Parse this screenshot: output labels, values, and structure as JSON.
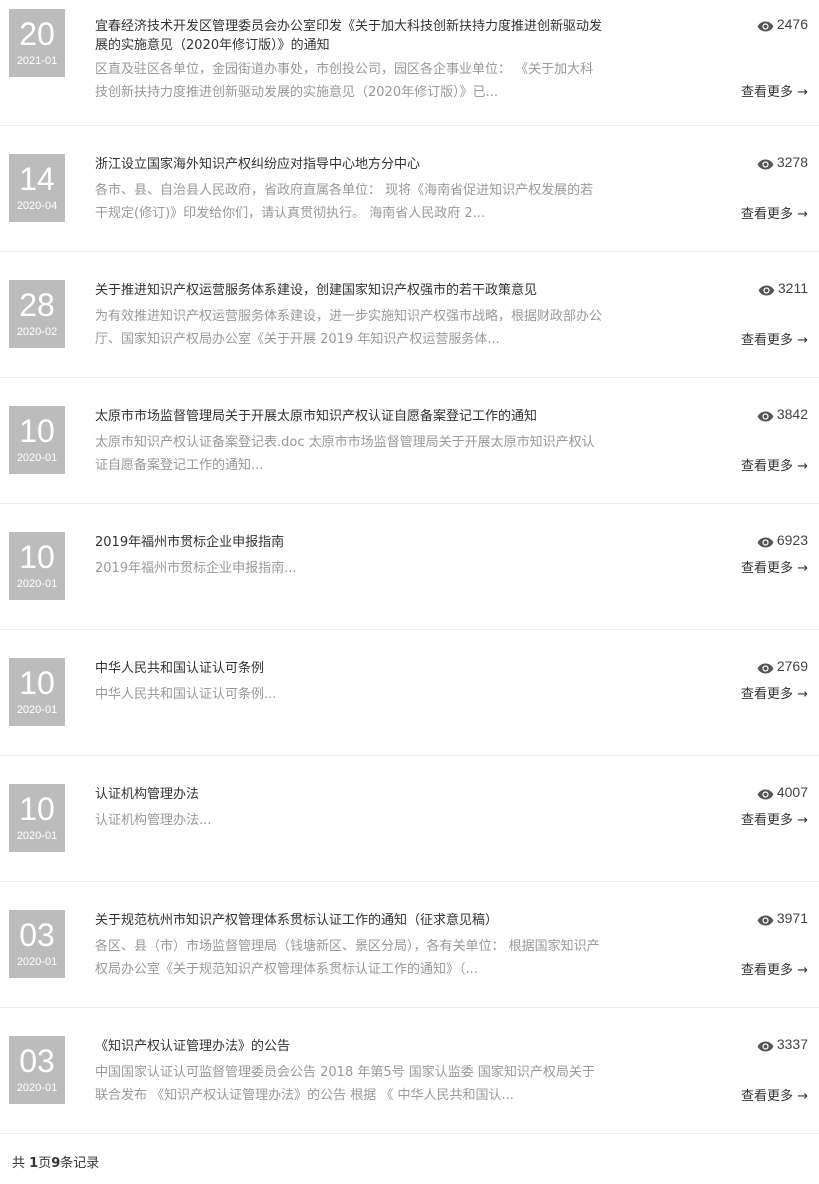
{
  "items": [
    {
      "day": "20",
      "ym": "2021-01",
      "title": "宜春经济技术开发区管理委员会办公室印发《关于加大科技创新扶持力度推进创新驱动发展的实施意见（2020年修订版）》的通知",
      "summary": "区直及驻区各单位，金园街道办事处，市创投公司，园区各企事业单位：  《关于加大科技创新扶持力度推进创新驱动发展的实施意见（2020年修订版）》已...",
      "views": "2476",
      "more": "查看更多 →"
    },
    {
      "day": "14",
      "ym": "2020-04",
      "title": "浙江设立国家海外知识产权纠纷应对指导中心地方分中心",
      "summary": "各市、县、自治县人民政府，省政府直属各单位：  现将《海南省促进知识产权发展的若干规定(修订)》印发给你们，请认真贯彻执行。  海南省人民政府  2...",
      "views": "3278",
      "more": "查看更多 →"
    },
    {
      "day": "28",
      "ym": "2020-02",
      "title": "关于推进知识产权运营服务体系建设，创建国家知识产权强市的若干政策意见",
      "summary": "为有效推进知识产权运营服务体系建设，进一步实施知识产权强市战略，根据财政部办公厅、国家知识产权局办公室《关于开展 2019 年知识产权运营服务体...",
      "views": "3211",
      "more": "查看更多 →"
    },
    {
      "day": "10",
      "ym": "2020-01",
      "title": "太原市市场监督管理局关于开展太原市知识产权认证自愿备案登记工作的通知",
      "summary": "太原市知识产权认证备案登记表.doc 太原市市场监督管理局关于开展太原市知识产权认证自愿备案登记工作的通知...",
      "views": "3842",
      "more": "查看更多 →"
    },
    {
      "day": "10",
      "ym": "2020-01",
      "title": "2019年福州市贯标企业申报指南",
      "summary": "2019年福州市贯标企业申报指南...",
      "views": "6923",
      "more": "查看更多 →"
    },
    {
      "day": "10",
      "ym": "2020-01",
      "title": "中华人民共和国认证认可条例",
      "summary": "中华人民共和国认证认可条例...",
      "views": "2769",
      "more": "查看更多 →"
    },
    {
      "day": "10",
      "ym": "2020-01",
      "title": "认证机构管理办法",
      "summary": "认证机构管理办法...",
      "views": "4007",
      "more": "查看更多 →"
    },
    {
      "day": "03",
      "ym": "2020-01",
      "title": "关于规范杭州市知识产权管理体系贯标认证工作的通知（征求意见稿）",
      "summary": "各区、县（市）市场监督管理局（钱塘新区、景区分局），各有关单位：  根据国家知识产权局办公室《关于规范知识产权管理体系贯标认证工作的通知》（...",
      "views": "3971",
      "more": "查看更多 →"
    },
    {
      "day": "03",
      "ym": "2020-01",
      "title": "《知识产权认证管理办法》的公告",
      "summary": "中国国家认证认可监督管理委员会公告 2018 年第5号 国家认监委 国家知识产权局关于联合发布 《知识产权认证管理办法》的公告 根据 《 中华人民共和国认...",
      "views": "3337",
      "more": "查看更多 →"
    }
  ],
  "footer": {
    "prefix": "共 ",
    "pages": "1",
    "page_word": "页",
    "count": "9",
    "suffix": "条记录"
  },
  "icons": {
    "view": "eye-icon"
  }
}
